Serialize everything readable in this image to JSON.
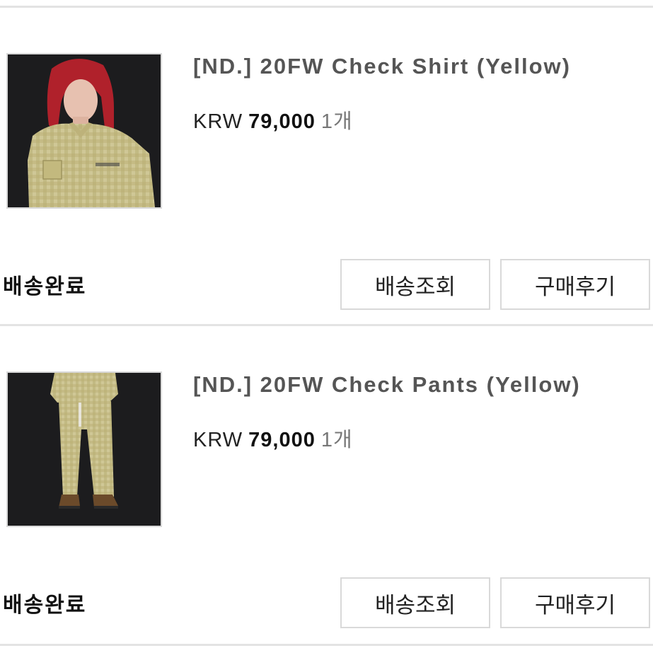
{
  "orders": [
    {
      "product_name": "[ND.] 20FW Check Shirt (Yellow)",
      "currency": "KRW",
      "price": "79,000",
      "quantity": "1개",
      "status": "배송완료",
      "track_label": "배송조회",
      "review_label": "구매후기",
      "image_icon": "product-photo-shirt"
    },
    {
      "product_name": "[ND.] 20FW Check Pants (Yellow)",
      "currency": "KRW",
      "price": "79,000",
      "quantity": "1개",
      "status": "배송완료",
      "track_label": "배송조회",
      "review_label": "구매후기",
      "image_icon": "product-photo-pants"
    }
  ],
  "colors": {
    "divider": "#e3e3e3",
    "button_border": "#d9d9d9",
    "name_text": "#555555",
    "photo_bg": "#1c1c1e",
    "check_yellow": "#c9c38a"
  }
}
